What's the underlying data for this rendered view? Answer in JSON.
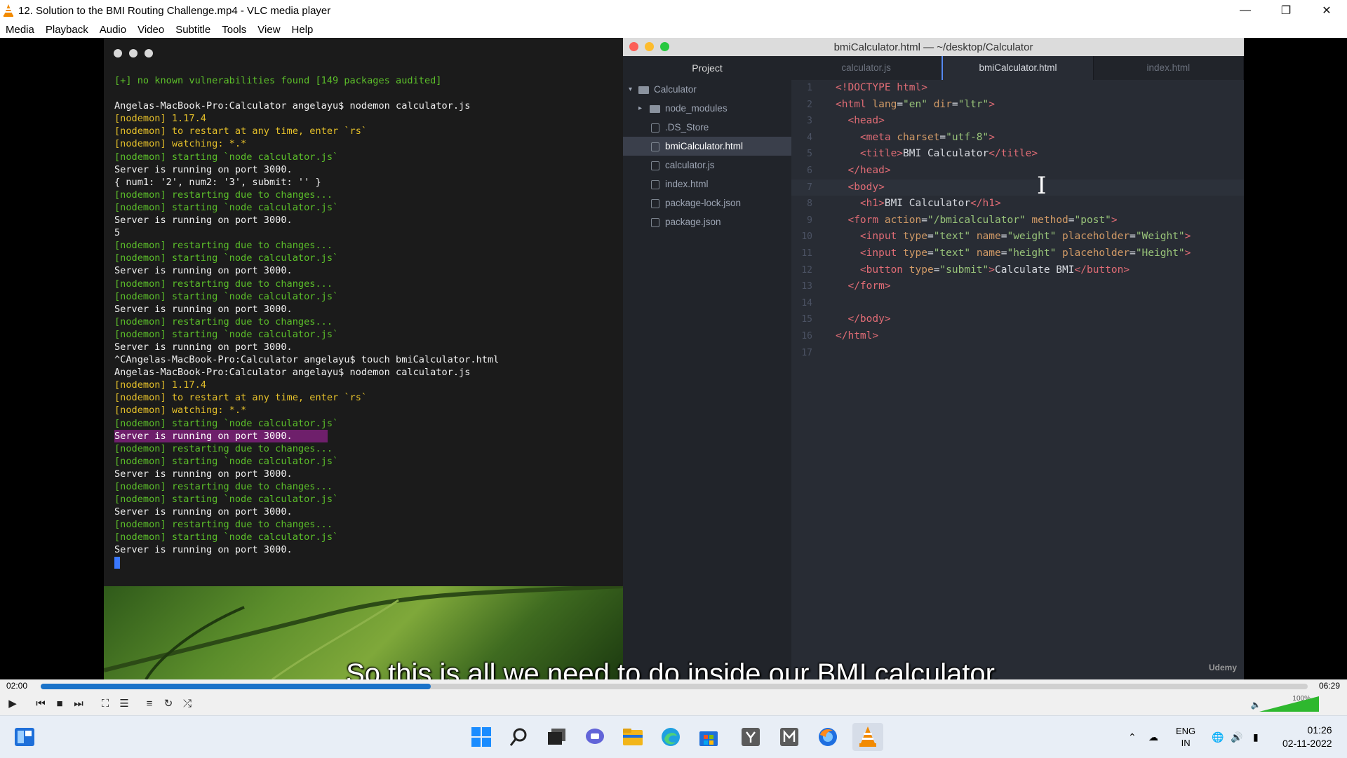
{
  "window": {
    "title": "12. Solution to the BMI Routing Challenge.mp4 - VLC media player"
  },
  "menu": [
    "Media",
    "Playback",
    "Audio",
    "Video",
    "Subtitle",
    "Tools",
    "View",
    "Help"
  ],
  "terminal": {
    "lines": [
      {
        "text": "[+] no known vulnerabilities found [149 packages audited]",
        "color": "green"
      },
      {
        "text": "",
        "color": "white"
      },
      {
        "text": "Angelas-MacBook-Pro:Calculator angelayu$ nodemon calculator.js",
        "color": "white"
      },
      {
        "text": "[nodemon] 1.17.4",
        "color": "yellow"
      },
      {
        "text": "[nodemon] to restart at any time, enter `rs`",
        "color": "yellow"
      },
      {
        "text": "[nodemon] watching: *.*",
        "color": "yellow"
      },
      {
        "text": "[nodemon] starting `node calculator.js`",
        "color": "green"
      },
      {
        "text": "Server is running on port 3000.",
        "color": "white"
      },
      {
        "text": "{ num1: '2', num2: '3', submit: '' }",
        "color": "white"
      },
      {
        "text": "[nodemon] restarting due to changes...",
        "color": "green"
      },
      {
        "text": "[nodemon] starting `node calculator.js`",
        "color": "green"
      },
      {
        "text": "Server is running on port 3000.",
        "color": "white"
      },
      {
        "text": "5",
        "color": "white"
      },
      {
        "text": "[nodemon] restarting due to changes...",
        "color": "green"
      },
      {
        "text": "[nodemon] starting `node calculator.js`",
        "color": "green"
      },
      {
        "text": "Server is running on port 3000.",
        "color": "white"
      },
      {
        "text": "[nodemon] restarting due to changes...",
        "color": "green"
      },
      {
        "text": "[nodemon] starting `node calculator.js`",
        "color": "green"
      },
      {
        "text": "Server is running on port 3000.",
        "color": "white"
      },
      {
        "text": "[nodemon] restarting due to changes...",
        "color": "green"
      },
      {
        "text": "[nodemon] starting `node calculator.js`",
        "color": "green"
      },
      {
        "text": "Server is running on port 3000.",
        "color": "white"
      },
      {
        "text": "^CAngelas-MacBook-Pro:Calculator angelayu$ touch bmiCalculator.html",
        "color": "white"
      },
      {
        "text": "Angelas-MacBook-Pro:Calculator angelayu$ nodemon calculator.js",
        "color": "white"
      },
      {
        "text": "[nodemon] 1.17.4",
        "color": "yellow"
      },
      {
        "text": "[nodemon] to restart at any time, enter `rs`",
        "color": "yellow"
      },
      {
        "text": "[nodemon] watching: *.*",
        "color": "yellow"
      },
      {
        "text": "[nodemon] starting `node calculator.js`",
        "color": "green"
      },
      {
        "text": "Server is running on port 3000.",
        "color": "hl"
      },
      {
        "text": "[nodemon] restarting due to changes...",
        "color": "green"
      },
      {
        "text": "[nodemon] starting `node calculator.js`",
        "color": "green"
      },
      {
        "text": "Server is running on port 3000.",
        "color": "white"
      },
      {
        "text": "[nodemon] restarting due to changes...",
        "color": "green"
      },
      {
        "text": "[nodemon] starting `node calculator.js`",
        "color": "green"
      },
      {
        "text": "Server is running on port 3000.",
        "color": "white"
      },
      {
        "text": "[nodemon] restarting due to changes...",
        "color": "green"
      },
      {
        "text": "[nodemon] starting `node calculator.js`",
        "color": "green"
      },
      {
        "text": "Server is running on port 3000.",
        "color": "white"
      }
    ]
  },
  "editor": {
    "title": "bmiCalculator.html — ~/desktop/Calculator",
    "project_label": "Project",
    "tree": [
      {
        "label": "Calculator",
        "type": "root"
      },
      {
        "label": "node_modules",
        "type": "folder"
      },
      {
        "label": ".DS_Store",
        "type": "file"
      },
      {
        "label": "bmiCalculator.html",
        "type": "file",
        "selected": true
      },
      {
        "label": "calculator.js",
        "type": "file"
      },
      {
        "label": "index.html",
        "type": "file"
      },
      {
        "label": "package-lock.json",
        "type": "file"
      },
      {
        "label": "package.json",
        "type": "file"
      }
    ],
    "tabs": [
      {
        "label": "calculator.js",
        "active": false
      },
      {
        "label": "bmiCalculator.html",
        "active": true
      },
      {
        "label": "index.html",
        "active": false
      }
    ],
    "code": [
      [
        [
          "tag",
          "<!DOCTYPE html>"
        ]
      ],
      [
        [
          "tag",
          "<html "
        ],
        [
          "attr",
          "lang"
        ],
        [
          "txt",
          "="
        ],
        [
          "str",
          "\"en\""
        ],
        [
          "txt",
          " "
        ],
        [
          "attr",
          "dir"
        ],
        [
          "txt",
          "="
        ],
        [
          "str",
          "\"ltr\""
        ],
        [
          "tag",
          ">"
        ]
      ],
      [
        [
          "txt",
          "  "
        ],
        [
          "tag",
          "<head>"
        ]
      ],
      [
        [
          "txt",
          "    "
        ],
        [
          "tag",
          "<meta "
        ],
        [
          "attr",
          "charset"
        ],
        [
          "txt",
          "="
        ],
        [
          "str",
          "\"utf-8\""
        ],
        [
          "tag",
          ">"
        ]
      ],
      [
        [
          "txt",
          "    "
        ],
        [
          "tag",
          "<title>"
        ],
        [
          "txt",
          "BMI Calculator"
        ],
        [
          "tag",
          "</title>"
        ]
      ],
      [
        [
          "txt",
          "  "
        ],
        [
          "tag",
          "</head>"
        ]
      ],
      [
        [
          "txt",
          "  "
        ],
        [
          "tag",
          "<body>"
        ]
      ],
      [
        [
          "txt",
          "    "
        ],
        [
          "tag",
          "<h1>"
        ],
        [
          "txt",
          "BMI Calculator"
        ],
        [
          "tag",
          "</h1>"
        ]
      ],
      [
        [
          "txt",
          "  "
        ],
        [
          "tag",
          "<form "
        ],
        [
          "attr",
          "action"
        ],
        [
          "txt",
          "="
        ],
        [
          "str",
          "\"/bmicalculator\""
        ],
        [
          "txt",
          " "
        ],
        [
          "attr",
          "method"
        ],
        [
          "txt",
          "="
        ],
        [
          "str",
          "\"post\""
        ],
        [
          "tag",
          ">"
        ]
      ],
      [
        [
          "txt",
          "    "
        ],
        [
          "tag",
          "<input "
        ],
        [
          "attr",
          "type"
        ],
        [
          "txt",
          "="
        ],
        [
          "str",
          "\"text\""
        ],
        [
          "txt",
          " "
        ],
        [
          "attr",
          "name"
        ],
        [
          "txt",
          "="
        ],
        [
          "str",
          "\"weight\""
        ],
        [
          "txt",
          " "
        ],
        [
          "attr",
          "placeholder"
        ],
        [
          "txt",
          "="
        ],
        [
          "str",
          "\"Weight\""
        ],
        [
          "tag",
          ">"
        ]
      ],
      [
        [
          "txt",
          "    "
        ],
        [
          "tag",
          "<input "
        ],
        [
          "attr",
          "type"
        ],
        [
          "txt",
          "="
        ],
        [
          "str",
          "\"text\""
        ],
        [
          "txt",
          " "
        ],
        [
          "attr",
          "name"
        ],
        [
          "txt",
          "="
        ],
        [
          "str",
          "\"height\""
        ],
        [
          "txt",
          " "
        ],
        [
          "attr",
          "placeholder"
        ],
        [
          "txt",
          "="
        ],
        [
          "str",
          "\"Height\""
        ],
        [
          "tag",
          ">"
        ]
      ],
      [
        [
          "txt",
          "    "
        ],
        [
          "tag",
          "<button "
        ],
        [
          "attr",
          "type"
        ],
        [
          "txt",
          "="
        ],
        [
          "str",
          "\"submit\""
        ],
        [
          "tag",
          ">"
        ],
        [
          "txt",
          "Calculate BMI"
        ],
        [
          "tag",
          "</button>"
        ]
      ],
      [
        [
          "txt",
          "  "
        ],
        [
          "tag",
          "</form>"
        ]
      ],
      [],
      [
        [
          "txt",
          "  "
        ],
        [
          "tag",
          "</body>"
        ]
      ],
      [
        [
          "tag",
          "</html>"
        ]
      ],
      []
    ],
    "current_line": 7,
    "watermark": "Udemy"
  },
  "subtitle": "So this is all we need to do inside our BMI calculator.",
  "player": {
    "time_elapsed": "02:00",
    "time_total": "06:29",
    "progress": 0.308,
    "volume_label": "100%",
    "volume": 1.0
  },
  "taskbar": {
    "lang": "ENG",
    "region": "IN",
    "time": "01:26",
    "date": "02-11-2022"
  },
  "colors": {
    "accent": "#1a73c9",
    "terminal_green": "#5cbf2a",
    "terminal_yellow": "#e5c02a",
    "highlight": "#6e1f6b"
  }
}
